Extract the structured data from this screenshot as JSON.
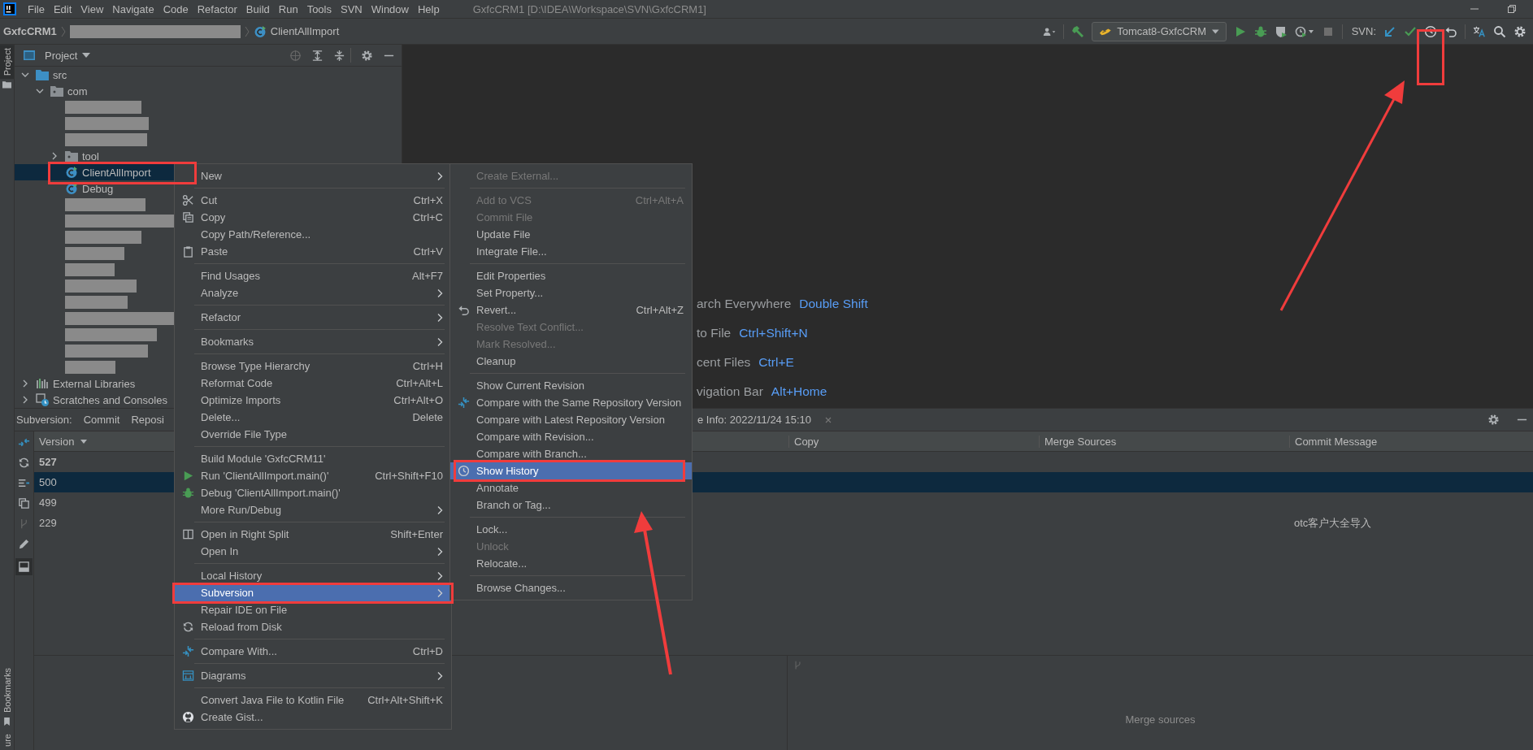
{
  "menu_bar": {
    "items": [
      "File",
      "Edit",
      "View",
      "Navigate",
      "Code",
      "Refactor",
      "Build",
      "Run",
      "Tools",
      "SVN",
      "Window",
      "Help"
    ],
    "title": "GxfcCRM1 [D:\\IDEA\\Workspace\\SVN\\GxfcCRM1]"
  },
  "nav_bar": {
    "crumbs": [
      {
        "kind": "project",
        "label": "GxfcCRM1"
      },
      {
        "kind": "redacted"
      },
      {
        "kind": "class",
        "label": "ClientAllImport"
      }
    ]
  },
  "toolbar": {
    "run_config": "Tomcat8-GxfcCRM",
    "svn_label": "SVN:"
  },
  "side_stripe": {
    "top": {
      "label": "Project",
      "selected": true
    },
    "bottom": [
      {
        "label": "Bookmarks",
        "selected": false
      },
      {
        "label": "ure",
        "selected": false
      }
    ]
  },
  "project_panel": {
    "title": "Project",
    "tree": [
      {
        "kind": "source-folder",
        "label": "src",
        "expanded": true,
        "selected": false,
        "children": [
          {
            "kind": "package",
            "label": "com",
            "expanded": true,
            "selected": false,
            "children": [
              {
                "kind": "redacted",
                "selected": false
              },
              {
                "kind": "redacted",
                "selected": false
              },
              {
                "kind": "redacted",
                "selected": false
              },
              {
                "kind": "package",
                "label": "tool",
                "expanded": false,
                "selected": false
              },
              {
                "kind": "class",
                "label": "ClientAllImport",
                "selected": true
              },
              {
                "kind": "class",
                "label": "Debug",
                "selected": false
              },
              {
                "kind": "redacted",
                "selected": false
              },
              {
                "kind": "redacted",
                "selected": false
              },
              {
                "kind": "redacted",
                "selected": false
              },
              {
                "kind": "redacted",
                "selected": false
              },
              {
                "kind": "redacted",
                "selected": false
              },
              {
                "kind": "redacted",
                "selected": false
              },
              {
                "kind": "redacted",
                "selected": false
              },
              {
                "kind": "redacted",
                "selected": false
              },
              {
                "kind": "redacted",
                "selected": false
              },
              {
                "kind": "redacted",
                "selected": false
              },
              {
                "kind": "redacted",
                "selected": false
              }
            ]
          }
        ]
      },
      {
        "kind": "library",
        "label": "External Libraries",
        "expanded": false,
        "selected": false
      },
      {
        "kind": "scratches",
        "label": "Scratches and Consoles",
        "expanded": false,
        "selected": false
      }
    ]
  },
  "editor_hints": [
    {
      "text": "arch Everywhere",
      "shortcut": "Double Shift"
    },
    {
      "text": "to File",
      "shortcut": "Ctrl+Shift+N"
    },
    {
      "text": "cent Files",
      "shortcut": "Ctrl+E"
    },
    {
      "text": "vigation Bar",
      "shortcut": "Alt+Home"
    }
  ],
  "bottom_panel": {
    "label": "Subversion:",
    "tabs": [
      "Commit",
      "Reposi",
      "e Info: 2022/11/24 15:10"
    ],
    "columns": [
      "Version",
      "Copy",
      "Merge Sources",
      "Commit Message"
    ],
    "rows": [
      {
        "version": "527",
        "message": "",
        "current": true,
        "selected": false
      },
      {
        "version": "500",
        "message": "",
        "current": false,
        "selected": true
      },
      {
        "version": "499",
        "message": "",
        "current": false,
        "selected": false
      },
      {
        "version": "229",
        "message": "otc客户大全导入",
        "current": false,
        "selected": false
      }
    ],
    "details_placeholder": "Merge sources"
  },
  "context_menu": {
    "items": [
      {
        "kind": "item",
        "label": "New",
        "submenu": true,
        "selected": false,
        "disabled": false
      },
      {
        "kind": "separator"
      },
      {
        "kind": "item",
        "label": "Cut",
        "shortcut": "Ctrl+X",
        "selected": false,
        "disabled": false
      },
      {
        "kind": "item",
        "label": "Copy",
        "shortcut": "Ctrl+C",
        "selected": false,
        "disabled": false
      },
      {
        "kind": "item",
        "label": "Copy Path/Reference...",
        "selected": false,
        "disabled": false
      },
      {
        "kind": "item",
        "label": "Paste",
        "shortcut": "Ctrl+V",
        "selected": false,
        "disabled": false
      },
      {
        "kind": "separator"
      },
      {
        "kind": "item",
        "label": "Find Usages",
        "shortcut": "Alt+F7",
        "selected": false,
        "disabled": false
      },
      {
        "kind": "item",
        "label": "Analyze",
        "submenu": true,
        "selected": false,
        "disabled": false
      },
      {
        "kind": "separator"
      },
      {
        "kind": "item",
        "label": "Refactor",
        "submenu": true,
        "selected": false,
        "disabled": false
      },
      {
        "kind": "separator"
      },
      {
        "kind": "item",
        "label": "Bookmarks",
        "submenu": true,
        "selected": false,
        "disabled": false
      },
      {
        "kind": "separator"
      },
      {
        "kind": "item",
        "label": "Browse Type Hierarchy",
        "shortcut": "Ctrl+H",
        "selected": false,
        "disabled": false
      },
      {
        "kind": "item",
        "label": "Reformat Code",
        "shortcut": "Ctrl+Alt+L",
        "selected": false,
        "disabled": false
      },
      {
        "kind": "item",
        "label": "Optimize Imports",
        "shortcut": "Ctrl+Alt+O",
        "selected": false,
        "disabled": false
      },
      {
        "kind": "item",
        "label": "Delete...",
        "shortcut": "Delete",
        "selected": false,
        "disabled": false
      },
      {
        "kind": "item",
        "label": "Override File Type",
        "selected": false,
        "disabled": false
      },
      {
        "kind": "separator"
      },
      {
        "kind": "item",
        "label": "Build Module 'GxfcCRM11'",
        "selected": false,
        "disabled": false
      },
      {
        "kind": "item",
        "label": "Run 'ClientAllImport.main()'",
        "shortcut": "Ctrl+Shift+F10",
        "selected": false,
        "disabled": false
      },
      {
        "kind": "item",
        "label": "Debug 'ClientAllImport.main()'",
        "selected": false,
        "disabled": false
      },
      {
        "kind": "item",
        "label": "More Run/Debug",
        "submenu": true,
        "selected": false,
        "disabled": false
      },
      {
        "kind": "separator"
      },
      {
        "kind": "item",
        "label": "Open in Right Split",
        "shortcut": "Shift+Enter",
        "selected": false,
        "disabled": false
      },
      {
        "kind": "item",
        "label": "Open In",
        "submenu": true,
        "selected": false,
        "disabled": false
      },
      {
        "kind": "separator"
      },
      {
        "kind": "item",
        "label": "Local History",
        "submenu": true,
        "selected": false,
        "disabled": false
      },
      {
        "kind": "item",
        "label": "Subversion",
        "submenu": true,
        "selected": true,
        "disabled": false
      },
      {
        "kind": "item",
        "label": "Repair IDE on File",
        "selected": false,
        "disabled": false
      },
      {
        "kind": "item",
        "label": "Reload from Disk",
        "selected": false,
        "disabled": false
      },
      {
        "kind": "separator"
      },
      {
        "kind": "item",
        "label": "Compare With...",
        "shortcut": "Ctrl+D",
        "selected": false,
        "disabled": false
      },
      {
        "kind": "separator"
      },
      {
        "kind": "item",
        "label": "Diagrams",
        "submenu": true,
        "selected": false,
        "disabled": false
      },
      {
        "kind": "separator"
      },
      {
        "kind": "item",
        "label": "Convert Java File to Kotlin File",
        "shortcut": "Ctrl+Alt+Shift+K",
        "selected": false,
        "disabled": false
      },
      {
        "kind": "item",
        "label": "Create Gist...",
        "selected": false,
        "disabled": false
      }
    ]
  },
  "submenu": {
    "items": [
      {
        "kind": "item",
        "label": "Create External...",
        "selected": false,
        "disabled": true
      },
      {
        "kind": "separator"
      },
      {
        "kind": "item",
        "label": "Add to VCS",
        "shortcut": "Ctrl+Alt+A",
        "selected": false,
        "disabled": true
      },
      {
        "kind": "item",
        "label": "Commit File",
        "selected": false,
        "disabled": true
      },
      {
        "kind": "item",
        "label": "Update File",
        "selected": false,
        "disabled": false
      },
      {
        "kind": "item",
        "label": "Integrate File...",
        "selected": false,
        "disabled": false
      },
      {
        "kind": "separator"
      },
      {
        "kind": "item",
        "label": "Edit Properties",
        "selected": false,
        "disabled": false
      },
      {
        "kind": "item",
        "label": "Set Property...",
        "selected": false,
        "disabled": false
      },
      {
        "kind": "item",
        "label": "Revert...",
        "shortcut": "Ctrl+Alt+Z",
        "selected": false,
        "disabled": false
      },
      {
        "kind": "item",
        "label": "Resolve Text Conflict...",
        "selected": false,
        "disabled": true
      },
      {
        "kind": "item",
        "label": "Mark Resolved...",
        "selected": false,
        "disabled": true
      },
      {
        "kind": "item",
        "label": "Cleanup",
        "selected": false,
        "disabled": false
      },
      {
        "kind": "separator"
      },
      {
        "kind": "item",
        "label": "Show Current Revision",
        "selected": false,
        "disabled": false
      },
      {
        "kind": "item",
        "label": "Compare with the Same Repository Version",
        "selected": false,
        "disabled": false
      },
      {
        "kind": "item",
        "label": "Compare with Latest Repository Version",
        "selected": false,
        "disabled": false
      },
      {
        "kind": "item",
        "label": "Compare with Revision...",
        "selected": false,
        "disabled": false
      },
      {
        "kind": "item",
        "label": "Compare with Branch...",
        "selected": false,
        "disabled": false
      },
      {
        "kind": "item",
        "label": "Show History",
        "selected": true,
        "disabled": false
      },
      {
        "kind": "item",
        "label": "Annotate",
        "selected": false,
        "disabled": false
      },
      {
        "kind": "item",
        "label": "Branch or Tag...",
        "selected": false,
        "disabled": false
      },
      {
        "kind": "separator"
      },
      {
        "kind": "item",
        "label": "Lock...",
        "selected": false,
        "disabled": false
      },
      {
        "kind": "item",
        "label": "Unlock",
        "selected": false,
        "disabled": true
      },
      {
        "kind": "item",
        "label": "Relocate...",
        "selected": false,
        "disabled": false
      },
      {
        "kind": "separator"
      },
      {
        "kind": "item",
        "label": "Browse Changes...",
        "selected": false,
        "disabled": false
      }
    ]
  }
}
